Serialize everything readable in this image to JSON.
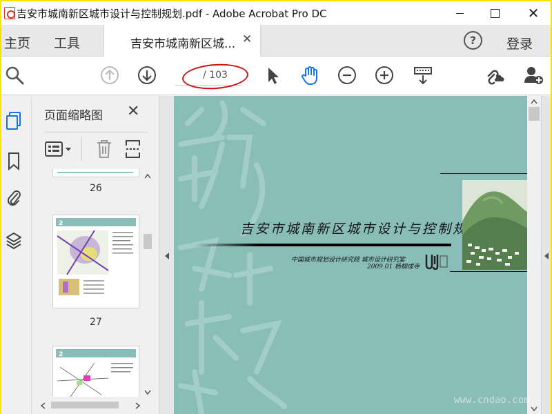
{
  "window": {
    "title": "吉安市城南新区城市设计与控制规划.pdf - Adobe Acrobat Pro DC",
    "close_glyph": "✕"
  },
  "tabs": {
    "home": "主页",
    "tools": "工具",
    "document": "吉安市城南新区城...",
    "document_close": "✕"
  },
  "header": {
    "help": "?",
    "login": "登录"
  },
  "toolbar": {
    "page_current": "",
    "page_total": "/ 103",
    "icons": [
      "search-icon",
      "page-up-icon",
      "page-down-icon",
      "select-arrow-icon",
      "hand-tool-icon",
      "zoom-out-icon",
      "zoom-in-icon",
      "keyboard-scroll-icon",
      "share-link-icon",
      "add-user-icon"
    ],
    "accent_color": "#1473e6",
    "annotation_color": "#d01010"
  },
  "thumbnails_panel": {
    "title": "页面缩略图",
    "close": "✕",
    "pages": [
      {
        "label": "26"
      },
      {
        "label": "27"
      },
      {
        "label": ""
      }
    ]
  },
  "document": {
    "title": "吉安市城南新区城市设计与控制规划",
    "subtitle_line1": "中国城市规划设计研究院  城市设计研究室",
    "subtitle_line2": "2009.01  杨柳成寺",
    "background_color": "#88bdb8"
  },
  "watermark": "www.cndao.com"
}
